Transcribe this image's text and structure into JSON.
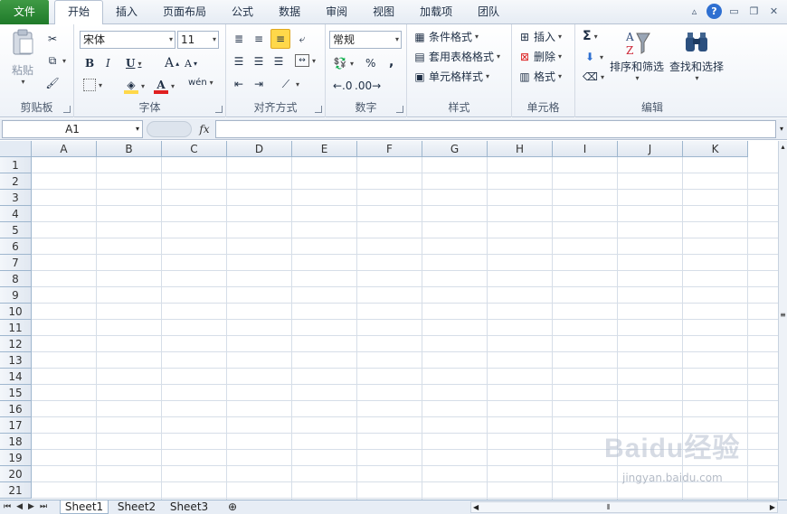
{
  "tabs": [
    "文件",
    "开始",
    "插入",
    "页面布局",
    "公式",
    "数据",
    "审阅",
    "视图",
    "加载项",
    "团队"
  ],
  "active_tab": "开始",
  "clipboard": {
    "paste_label": "粘贴",
    "group_label": "剪贴板"
  },
  "font": {
    "name": "宋体",
    "size": "11",
    "group_label": "字体",
    "bold": "B",
    "italic": "I",
    "underline": "U",
    "grow": "A",
    "shrink": "A",
    "font_color": "A",
    "phonetic": "wén"
  },
  "alignment": {
    "group_label": "对齐方式"
  },
  "number": {
    "format": "常规",
    "percent": "%",
    "comma": ",",
    "group_label": "数字"
  },
  "styles": {
    "conditional": "条件格式",
    "table": "套用表格格式",
    "cell_styles": "单元格样式",
    "group_label": "样式"
  },
  "cells": {
    "insert": "插入",
    "delete": "删除",
    "format": "格式",
    "group_label": "单元格"
  },
  "editing": {
    "sum": "Σ",
    "sort_filter": "排序和筛选",
    "find_select": "查找和选择",
    "group_label": "编辑"
  },
  "formula_bar": {
    "name_box": "A1",
    "fx": "fx"
  },
  "columns": [
    "A",
    "B",
    "C",
    "D",
    "E",
    "F",
    "G",
    "H",
    "I",
    "J",
    "K"
  ],
  "rows": [
    "1",
    "2",
    "3",
    "4",
    "5",
    "6",
    "7",
    "8",
    "9",
    "10",
    "11",
    "12",
    "13",
    "14",
    "15",
    "16",
    "17",
    "18",
    "19",
    "20",
    "21"
  ],
  "sheets": [
    "Sheet1",
    "Sheet2",
    "Sheet3"
  ],
  "active_sheet": "Sheet1",
  "watermark": {
    "logo": "Baidu经验",
    "url": "jingyan.baidu.com"
  },
  "colors": {
    "file_tab": "#2a8a35",
    "accent": "#2e6fd1",
    "highlight": "#ffd84a",
    "font_red": "#e02020"
  }
}
